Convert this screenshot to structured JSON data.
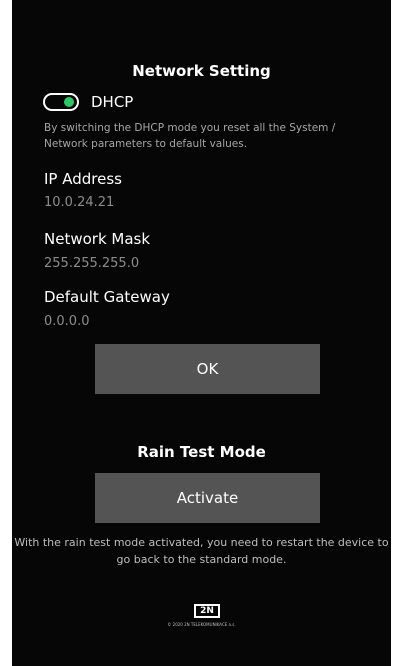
{
  "network": {
    "title": "Network Setting",
    "dhcp": {
      "label": "DHCP",
      "enabled": true,
      "description": "By switching the DHCP mode you reset all the System / Network parameters to default values."
    },
    "ip_address": {
      "label": "IP Address",
      "value": "10.0.24.21"
    },
    "network_mask": {
      "label": "Network Mask",
      "value": "255.255.255.0"
    },
    "default_gateway": {
      "label": "Default Gateway",
      "value": "0.0.0.0"
    },
    "ok_label": "OK"
  },
  "rain_test": {
    "title": "Rain Test Mode",
    "activate_label": "Activate",
    "description": "With the rain test mode activated, you need to restart the device to go back to the standard mode."
  },
  "footer": {
    "logo_text": "2N",
    "copyright": "© 2020 2N TELEKOMUNIKACE a.s."
  },
  "colors": {
    "background": "#060606",
    "button": "#545454",
    "toggle_on": "#2ec766",
    "muted_text": "#8c8c8c"
  },
  "icons": {
    "toggle": "dhcp-toggle-switch",
    "logo": "2n-logo-icon"
  }
}
